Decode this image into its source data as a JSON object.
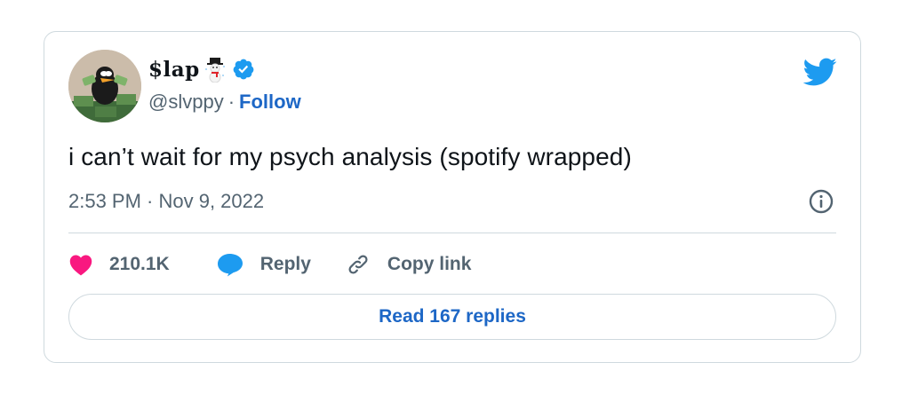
{
  "author": {
    "display_name": "$lap",
    "handle": "@slvppy",
    "separator": "·",
    "follow_label": "Follow",
    "verified_color": "#1d9bf0"
  },
  "tweet": {
    "text": "i can’t wait for my psych analysis (spotify wrapped)",
    "timestamp": "2:53 PM · Nov 9, 2022"
  },
  "actions": {
    "like_count": "210.1K",
    "reply_label": "Reply",
    "copy_link_label": "Copy link"
  },
  "read_replies_label": "Read 167 replies",
  "icons": [
    "snowman-emoji-icon",
    "verified-badge-icon",
    "twitter-bird-icon",
    "info-icon",
    "heart-icon",
    "reply-bubble-icon",
    "link-icon"
  ],
  "colors": {
    "accent": "#1d67c6",
    "twitter_blue": "#1d9bf0",
    "like_pink": "#f91880",
    "secondary_text": "#536471",
    "border": "#cfd9de"
  }
}
